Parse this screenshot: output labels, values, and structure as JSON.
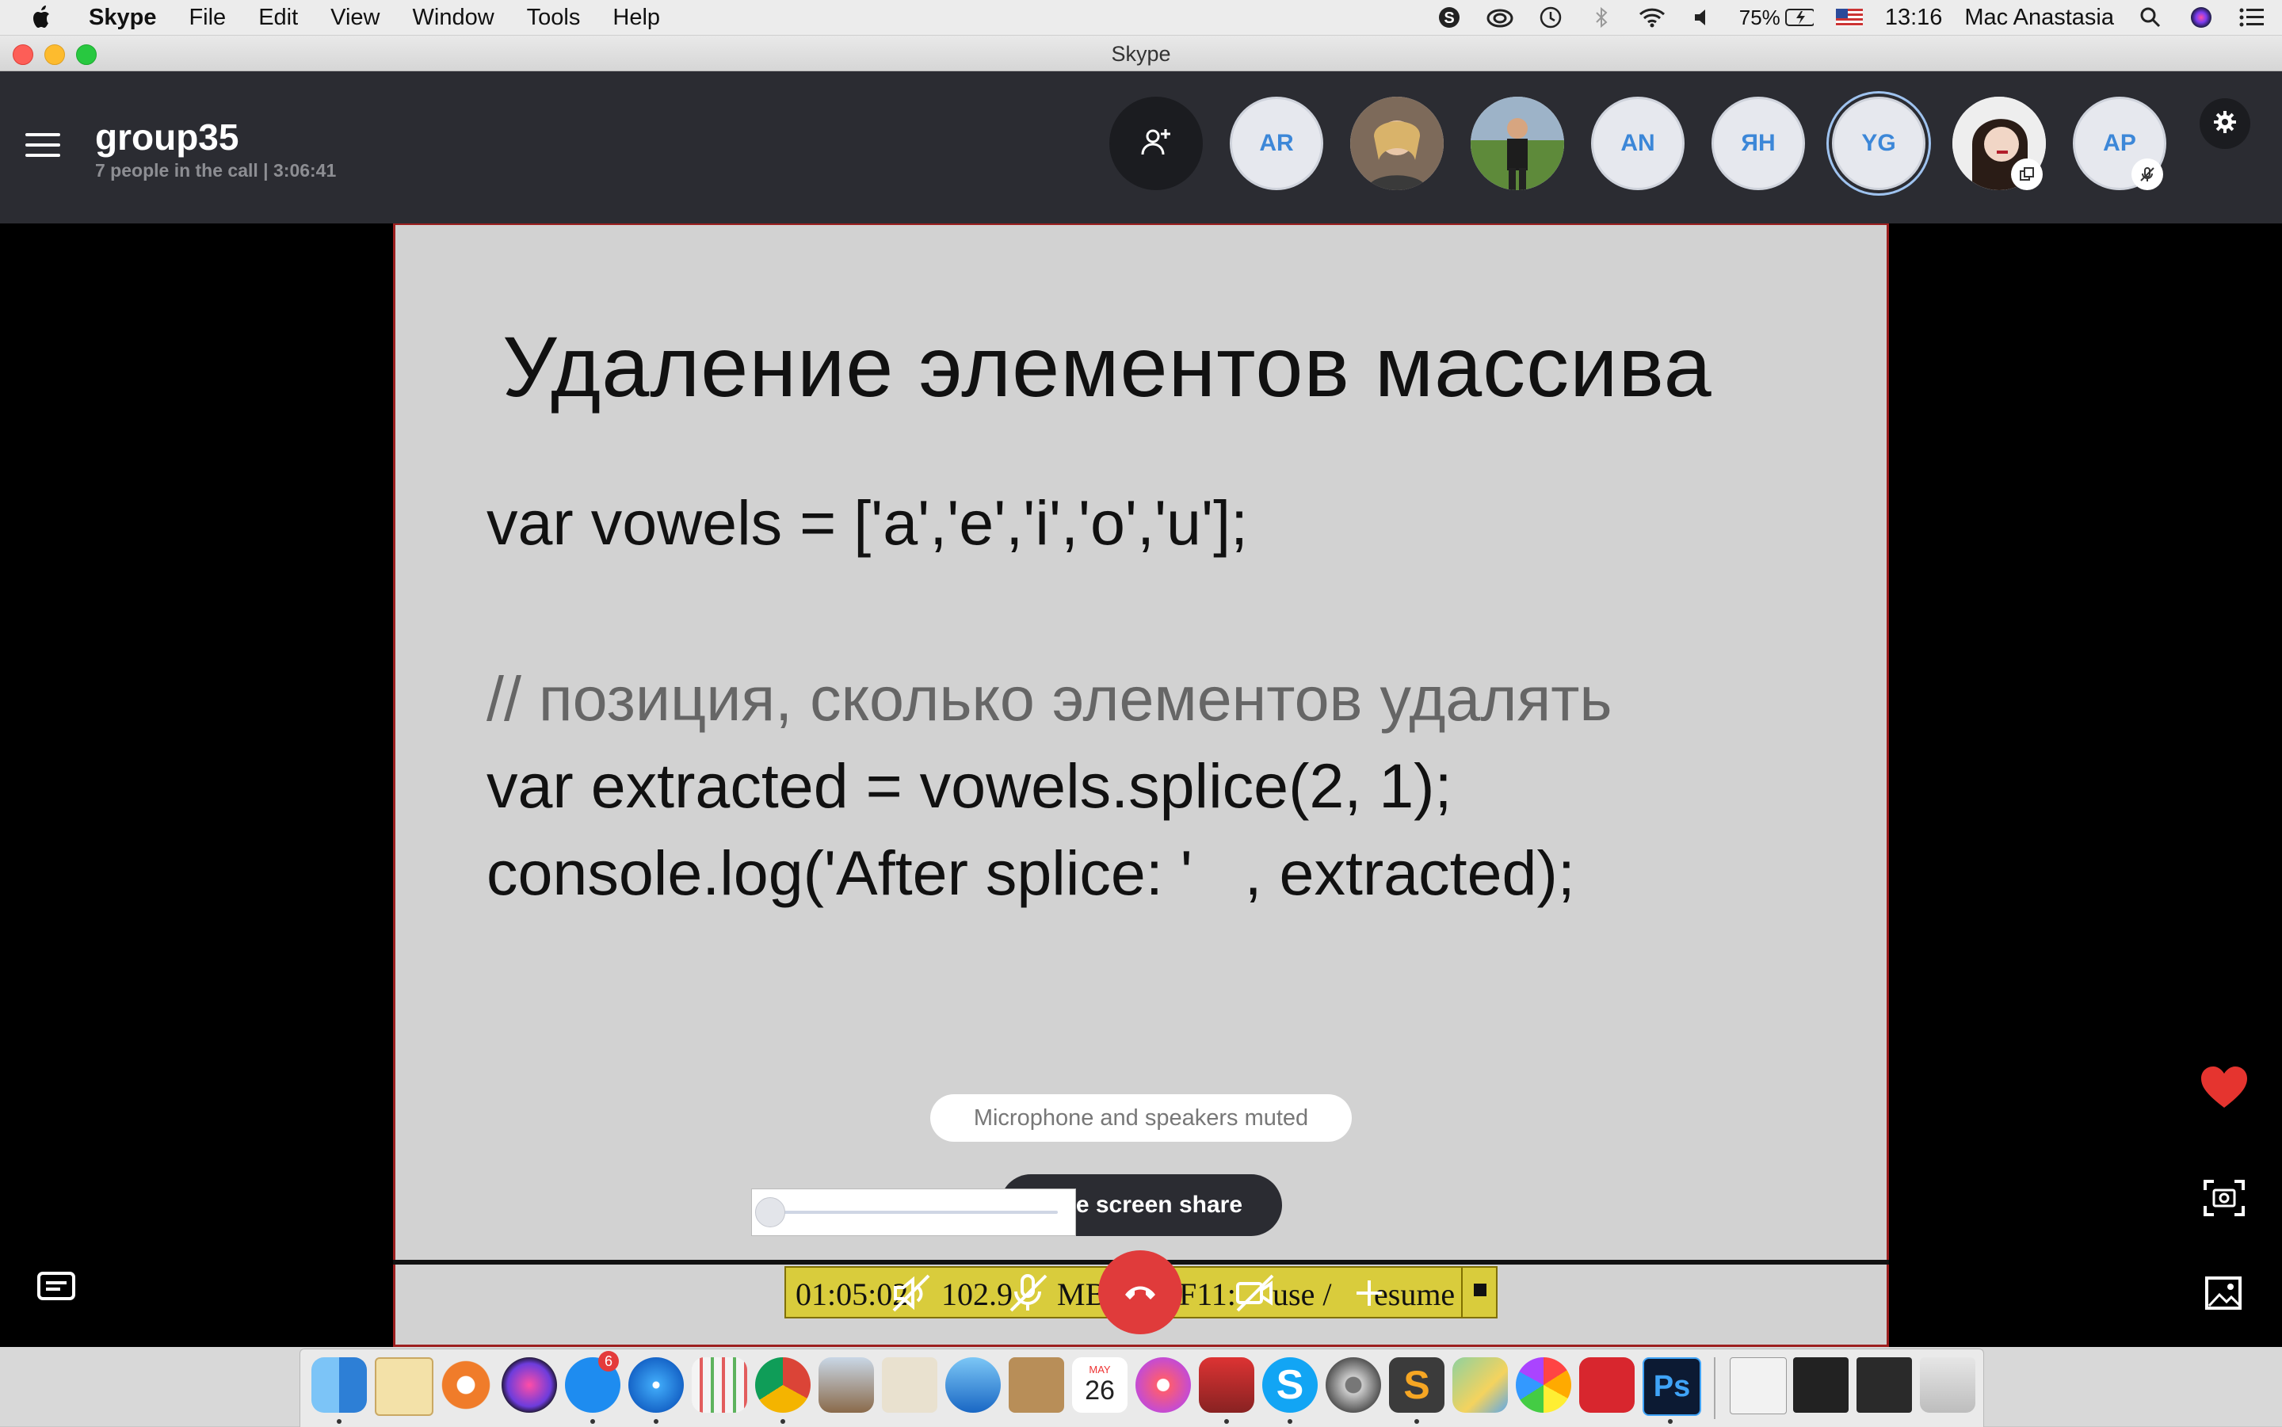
{
  "menubar": {
    "app_name": "Skype",
    "items": [
      "File",
      "Edit",
      "View",
      "Window",
      "Tools",
      "Help"
    ],
    "battery": "75%",
    "clock": "13:16",
    "user": "Mac Anastasia"
  },
  "window": {
    "title": "Skype"
  },
  "call": {
    "group_name": "group35",
    "info": "7 people in the call | 3:06:41",
    "participants": [
      "AR",
      "",
      "",
      "AN",
      "ЯН",
      "YG",
      "",
      "AP"
    ]
  },
  "slide": {
    "title": "Удаление элементов массива",
    "line1": "var vowels = ['a','e','i','o','u'];",
    "comment": "// позиция, сколько элементов удалять",
    "line2": "var extracted = vowels.splice(2, 1);",
    "line3": "console.log('After splice: '   , extracted);"
  },
  "overlay": {
    "mute_toast": "Microphone and speakers muted",
    "stop_share": "le screen share"
  },
  "recorder": {
    "time": "01:05:02",
    "size": "102.9 MB",
    "size_visible": "102.9",
    "size_unit": "MB",
    "hint": "F11: Pause / Resume",
    "hint_visible_a": "F11:",
    "hint_visible_b": "use /",
    "hint_visible_c": "esume"
  },
  "dock": {
    "appstore_badge": "6",
    "calendar_month": "MAY",
    "calendar_day": "26"
  },
  "colors": {
    "header_bg": "#2b2c32",
    "accent_blue": "#3c87d8",
    "hangup_red": "#e03b3b",
    "heart_red": "#e5342f",
    "recorder_yellow": "#d9cc3c",
    "slide_border": "#9c1f1f"
  },
  "icons": {
    "add_person": "add-person-icon",
    "settings": "gear-icon",
    "chat": "chat-icon",
    "heart": "heart-icon",
    "snapshot": "snapshot-icon",
    "gallery": "gallery-icon",
    "hangup": "hangup-icon"
  }
}
